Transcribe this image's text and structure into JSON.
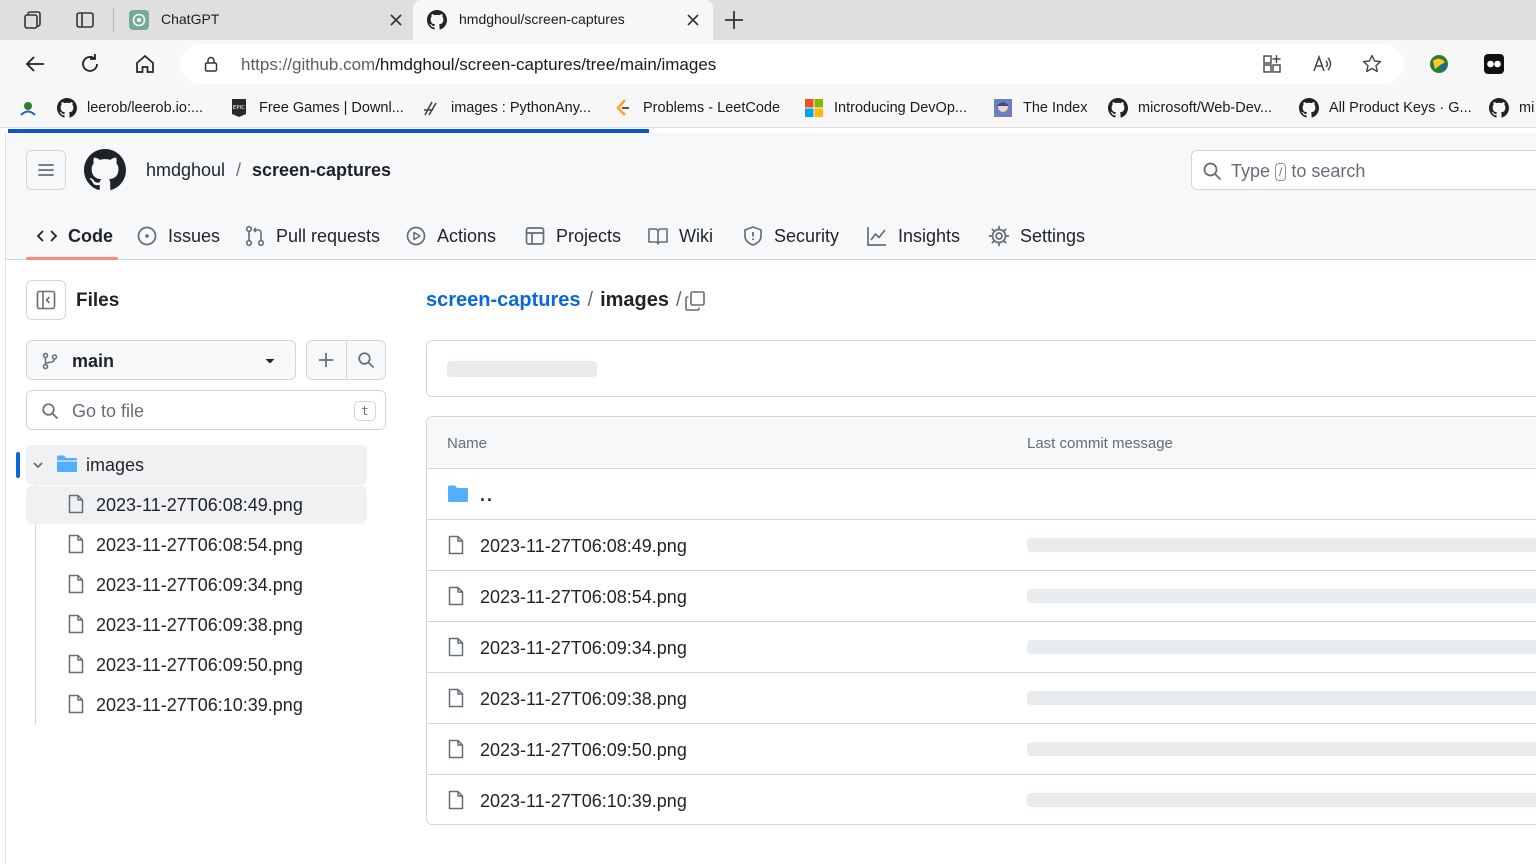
{
  "browser": {
    "tabs": [
      {
        "title": "ChatGPT",
        "icon": "chatgpt-icon",
        "active": false
      },
      {
        "title": "hmdghoul/screen-captures",
        "icon": "github-icon",
        "active": true
      }
    ],
    "url_host": "https://github.com",
    "url_path": "/hmdghoul/screen-captures/tree/main/images",
    "bookmarks": [
      {
        "label": "",
        "icon": "edge-site-icon"
      },
      {
        "label": "leerob/leerob.io:...",
        "icon": "github-icon"
      },
      {
        "label": "Free Games | Downl...",
        "icon": "epic-games-icon"
      },
      {
        "label": "images : PythonAny...",
        "icon": "pythonanywhere-icon"
      },
      {
        "label": "Problems - LeetCode",
        "icon": "leetcode-icon"
      },
      {
        "label": "Introducing DevOp...",
        "icon": "microsoft-icon"
      },
      {
        "label": "The Index",
        "icon": "anime-avatar-icon"
      },
      {
        "label": "microsoft/Web-Dev...",
        "icon": "github-icon"
      },
      {
        "label": "All Product Keys · G...",
        "icon": "github-icon"
      },
      {
        "label": "mi",
        "icon": "github-icon"
      }
    ]
  },
  "repo": {
    "owner": "hmdghoul",
    "separator": "/",
    "name": "screen-captures",
    "search_prefix": "Type",
    "search_key": "/",
    "search_suffix": "to search"
  },
  "nav": [
    {
      "label": "Code",
      "icon": "code-icon",
      "selected": true
    },
    {
      "label": "Issues",
      "icon": "issue-icon"
    },
    {
      "label": "Pull requests",
      "icon": "pull-request-icon"
    },
    {
      "label": "Actions",
      "icon": "play-icon"
    },
    {
      "label": "Projects",
      "icon": "table-icon"
    },
    {
      "label": "Wiki",
      "icon": "book-icon"
    },
    {
      "label": "Security",
      "icon": "shield-icon"
    },
    {
      "label": "Insights",
      "icon": "graph-icon"
    },
    {
      "label": "Settings",
      "icon": "gear-icon"
    }
  ],
  "sidebar": {
    "title": "Files",
    "branch": "main",
    "goto_placeholder": "Go to file",
    "goto_shortcut": "t",
    "folder": "images",
    "files": [
      "2023-11-27T06:08:49.png",
      "2023-11-27T06:08:54.png",
      "2023-11-27T06:09:34.png",
      "2023-11-27T06:09:38.png",
      "2023-11-27T06:09:50.png",
      "2023-11-27T06:10:39.png"
    ]
  },
  "main": {
    "path_root": "screen-captures",
    "path_sep": "/",
    "path_current": "images",
    "path_trailing": "/",
    "table": {
      "col_name": "Name",
      "col_message": "Last commit message",
      "parent": "..",
      "rows": [
        "2023-11-27T06:08:49.png",
        "2023-11-27T06:08:54.png",
        "2023-11-27T06:09:34.png",
        "2023-11-27T06:09:38.png",
        "2023-11-27T06:09:50.png",
        "2023-11-27T06:10:39.png"
      ]
    }
  },
  "colors": {
    "accent_link": "#0969da",
    "nav_underline": "#fd8c73",
    "folder_icon": "#54aeff",
    "loading_bar": "#0b57d0"
  }
}
